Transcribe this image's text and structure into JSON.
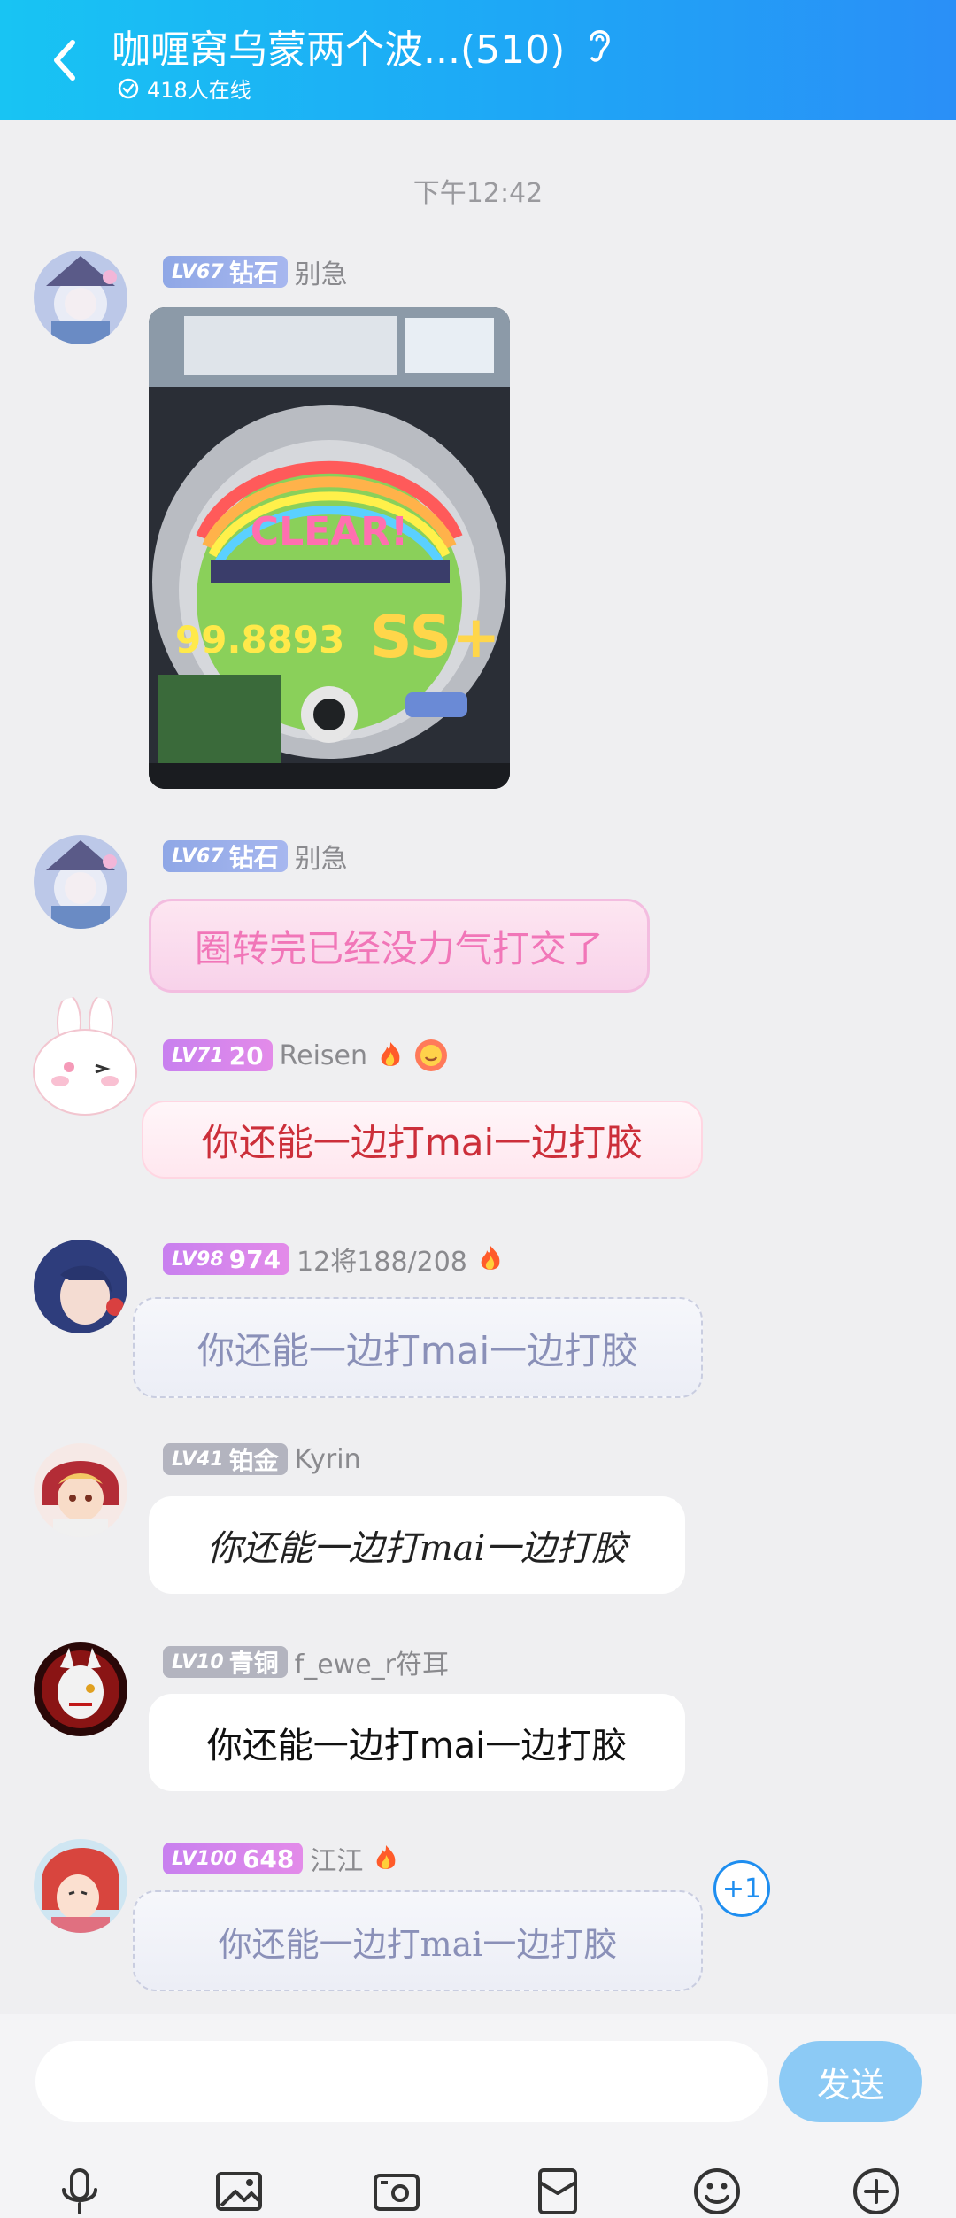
{
  "header": {
    "title": "咖喱窝乌蒙两个波...(510)",
    "online": "418人在线"
  },
  "chat": {
    "time": "下午12:42",
    "messages": [
      {
        "level": "LV67",
        "rank": "钻石",
        "sender": "别急",
        "type": "image"
      },
      {
        "level": "LV67",
        "rank": "钻石",
        "sender": "别急",
        "text": "圈转完已经没力气打交了"
      },
      {
        "level": "LV71",
        "rank": "20",
        "sender": "Reisen",
        "text": "你还能一边打mai一边打胶"
      },
      {
        "level": "LV98",
        "rank": "974",
        "sender": "12将188/208",
        "text": "你还能一边打mai一边打胶"
      },
      {
        "level": "LV41",
        "rank": "铂金",
        "sender": "Kyrin",
        "text": "你还能一边打mai一边打胶"
      },
      {
        "level": "LV10",
        "rank": "青铜",
        "sender": "f_ewe_r符耳",
        "text": "你还能一边打mai一边打胶"
      },
      {
        "level": "LV100",
        "rank": "648",
        "sender": "江江",
        "text": "你还能一边打mai一边打胶"
      }
    ],
    "plus_one": "+1",
    "photo": {
      "clear_text": "CLEAR!",
      "score": "99.8893",
      "rank": "SS+"
    }
  },
  "input": {
    "placeholder": "",
    "send_label": "发送"
  },
  "colors": {
    "accent": "#1ea7f6",
    "send": "#8ccaf5"
  }
}
